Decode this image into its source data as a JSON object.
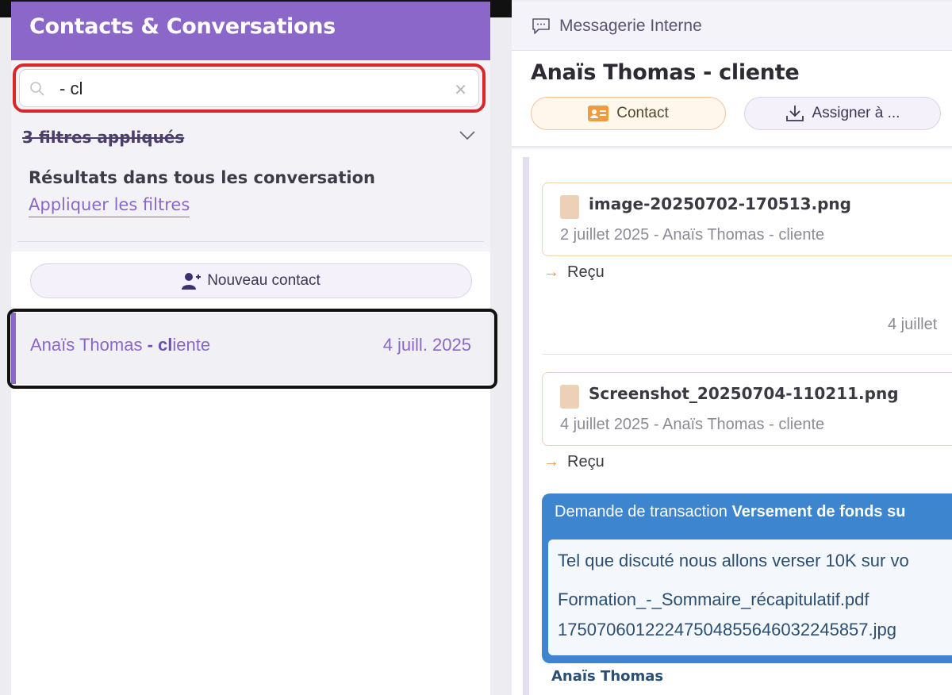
{
  "left_panel": {
    "title": "Contacts & Conversations",
    "search": {
      "value": "- cl",
      "placeholder": ""
    },
    "filters_label": "3 filtres appliqués",
    "results_heading": "Résultats dans tous les conversation",
    "apply_filters_link": "Appliquer les filtres",
    "new_contact_label": "Nouveau contact",
    "conversations": [
      {
        "name_prefix": "Anaïs Thomas ",
        "name_match": "- cl",
        "name_suffix": "iente",
        "date": "4 juill. 2025"
      }
    ]
  },
  "right_panel": {
    "top_label": "Messagerie Interne",
    "title": "Anaïs Thomas - cliente",
    "contact_button": "Contact",
    "assign_button": "Assigner à ...",
    "messages": [
      {
        "file_name": "image-20250702-170513.png",
        "meta": "2 juillet 2025 - Anaïs Thomas - cliente",
        "status": "Reçu"
      },
      {
        "file_name": "Screenshot_20250704-110211.png",
        "meta": "4 juillet 2025 - Anaïs Thomas - cliente",
        "status": "Reçu"
      }
    ],
    "timestamp_partial": "4 juillet",
    "transaction": {
      "prefix": "Demande de transaction ",
      "bold": "Versement de fonds su",
      "text": "Tel que discuté nous allons verser 10K sur vo",
      "attachments": [
        "Formation_-_Sommaire_récapitulatif.pdf",
        "17507060122247504855646032245857.jpg"
      ]
    },
    "author": "Anaïs Thomas"
  },
  "colors": {
    "accent": "#8a67c9",
    "search_highlight": "#d9262b",
    "transaction_blue": "#3d86cf",
    "orange_accent": "#e89a4a"
  }
}
